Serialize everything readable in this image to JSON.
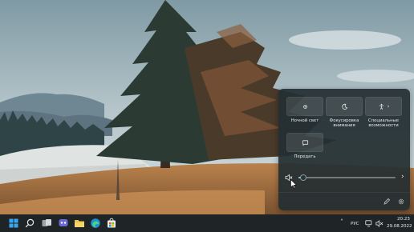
{
  "quick_settings": {
    "tiles": [
      {
        "id": "night-light",
        "label": "Ночной свет",
        "icon": "night-light-icon",
        "active": false
      },
      {
        "id": "focus-assist",
        "label": "Фокусировка\nвнимания",
        "icon": "moon-icon",
        "active": false
      },
      {
        "id": "accessibility",
        "label": "Специальные\nвозможности",
        "icon": "accessibility-icon",
        "has_chevron": true,
        "active": false
      },
      {
        "id": "cast",
        "label": "Передать",
        "icon": "cast-icon",
        "active": false
      }
    ],
    "volume": {
      "level": 0.05,
      "muted": true,
      "icon": "speaker-muted-icon"
    },
    "footer": {
      "edit_icon": "pencil-icon",
      "settings_icon": "gear-icon"
    }
  },
  "taskbar": {
    "icons": [
      "windows-start-icon",
      "search-icon",
      "task-view-icon",
      "teams-chat-icon",
      "file-explorer-icon",
      "edge-icon",
      "store-icon"
    ],
    "tray": {
      "language": "РУС",
      "time": "20:23",
      "date": "29.08.2022"
    }
  },
  "colors": {
    "accent": "#7fd3e8",
    "panel_bg": "#242e32",
    "taskbar_bg": "#1f2527"
  }
}
